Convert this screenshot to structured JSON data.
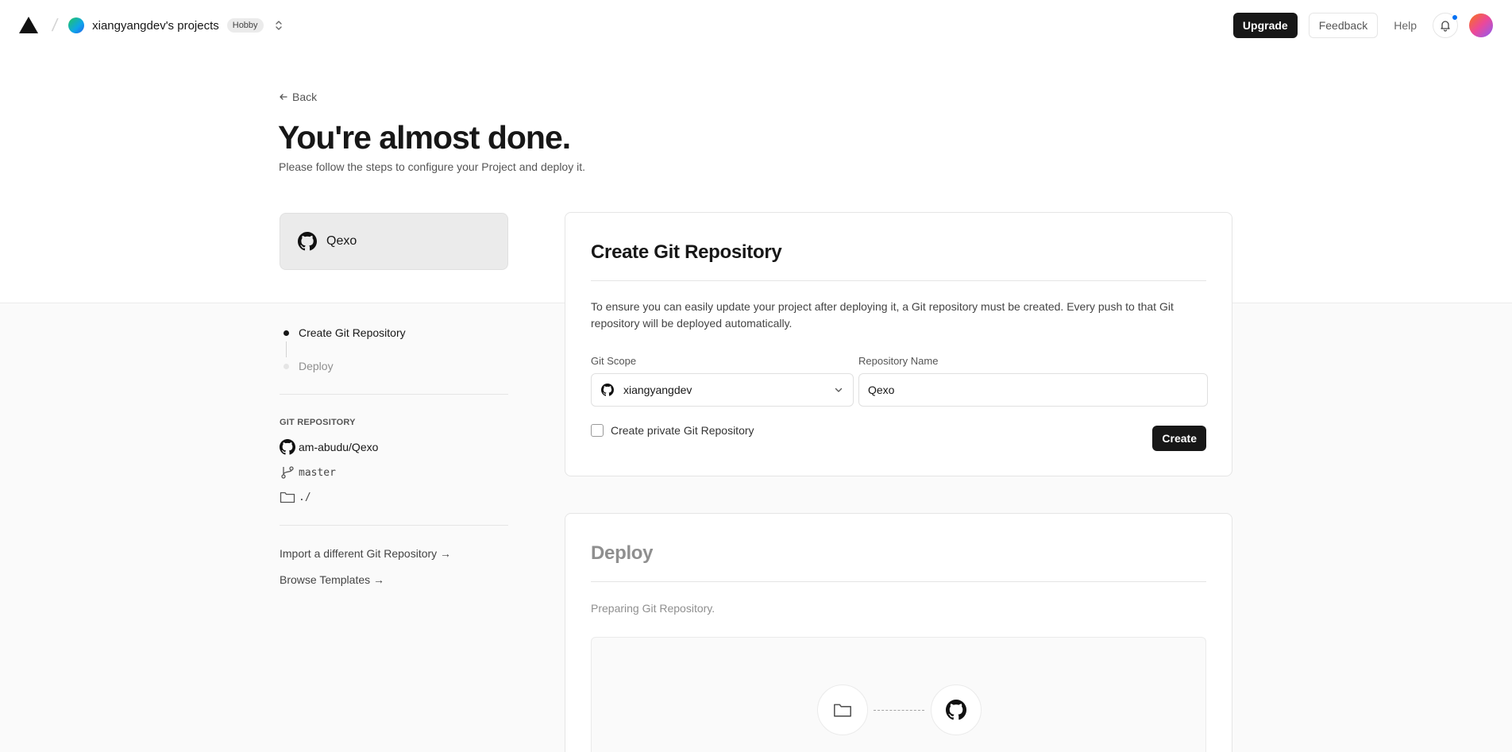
{
  "header": {
    "team_name": "xiangyangdev's projects",
    "plan_badge": "Hobby",
    "upgrade_label": "Upgrade",
    "feedback_label": "Feedback",
    "help_label": "Help",
    "icons": [
      "triangle-logo-icon",
      "scope-switch-icon",
      "bell-icon"
    ]
  },
  "page": {
    "back_label": "Back",
    "title": "You're almost done.",
    "subtitle": "Please follow the steps to configure your Project and deploy it."
  },
  "template": {
    "name": "Qexo"
  },
  "steps": [
    {
      "label": "Create Git Repository",
      "active": true
    },
    {
      "label": "Deploy",
      "active": false
    }
  ],
  "git_repository": {
    "heading": "GIT REPOSITORY",
    "repo": "am-abudu/Qexo",
    "branch": "master",
    "root": "./"
  },
  "sidebar_links": {
    "import_label": "Import a different Git Repository →",
    "templates_label": "Browse Templates →"
  },
  "create_repo": {
    "title": "Create Git Repository",
    "description": "To ensure you can easily update your project after deploying it, a Git repository must be created. Every push to that Git repository will be deployed automatically.",
    "scope_label": "Git Scope",
    "scope_value": "xiangyangdev",
    "name_label": "Repository Name",
    "name_value": "Qexo",
    "private_label": "Create private Git Repository",
    "private_checked": false,
    "create_label": "Create"
  },
  "deploy": {
    "title": "Deploy",
    "status": "Preparing Git Repository."
  },
  "colors": {
    "primary": "#171717",
    "accent_blue": "#0070f3",
    "muted": "#8f8f8f"
  }
}
